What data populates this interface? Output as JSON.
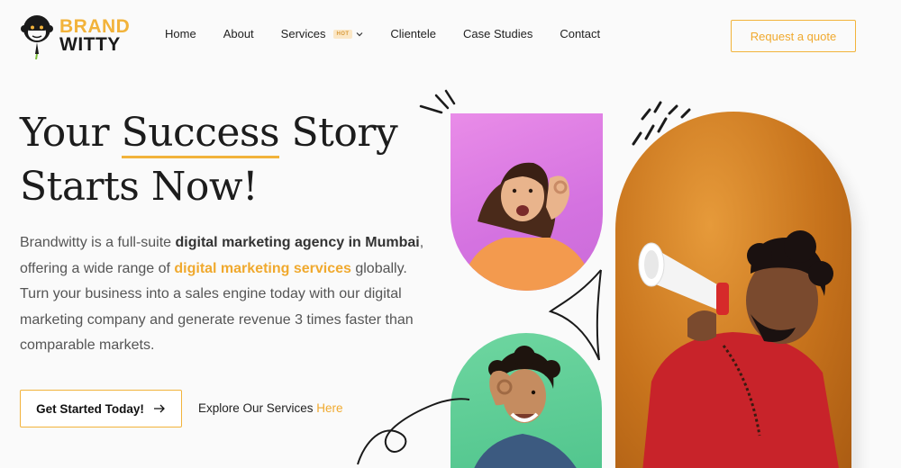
{
  "brand": {
    "name_line1": "BRAND",
    "name_line2": "WITTY",
    "accent": "#f2b33b"
  },
  "nav": {
    "items": [
      {
        "label": "Home"
      },
      {
        "label": "About"
      },
      {
        "label": "Services",
        "badge": "HOT",
        "icon": "chevron-down-icon"
      },
      {
        "label": "Clientele"
      },
      {
        "label": "Case Studies"
      },
      {
        "label": "Contact"
      }
    ],
    "quote_button": "Request a quote"
  },
  "hero": {
    "headline_part1": "Your ",
    "headline_highlight": "Success",
    "headline_part2": " Story",
    "headline_line2": "Starts Now!",
    "desc": {
      "t1": "Brandwitty is a full-suite ",
      "b1": "digital marketing agency in Mumbai",
      "t2": ", offering a wide range of ",
      "a1": "digital marketing services",
      "t3": " globally. Turn your business into a sales engine today with our digital marketing company and generate revenue 3 times faster than comparable markets."
    },
    "cta_label": "Get Started Today!",
    "cta_icon": "arrow-right-icon",
    "explore_text": "Explore Our Services ",
    "explore_link": "Here"
  },
  "images": {
    "pink": "woman-listening-photo",
    "green": "man-ok-gesture-photo",
    "orange": "man-megaphone-photo"
  }
}
